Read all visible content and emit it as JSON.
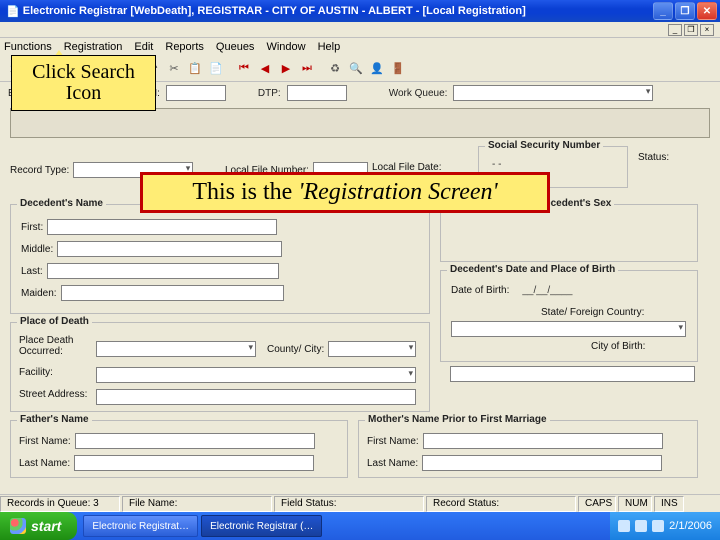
{
  "window": {
    "title": "Electronic Registrar [WebDeath], REGISTRAR - CITY OF AUSTIN - ALBERT  - [Local Registration]"
  },
  "menu": [
    "Functions",
    "Registration",
    "Edit",
    "Reports",
    "Queues",
    "Window",
    "Help"
  ],
  "toolbar": {
    "items": [
      "up",
      "binoc",
      "open",
      "save",
      "saveall",
      "print",
      "undo",
      "cut",
      "copy",
      "paste",
      "first",
      "prev",
      "next",
      "last",
      "upd",
      "audit",
      "person",
      "exit"
    ],
    "tooltip": "Find Record(s)"
  },
  "searchbar": {
    "edr": "EDR #:",
    "lfn": "LFN:",
    "dtp": "DTP:",
    "wq": "Work Queue:"
  },
  "labels": {
    "recType": "Record Type:",
    "locFile": "Local File Number:",
    "locFileDate": "Local File Date:",
    "ssn": "Social Security Number",
    "status": "Status:",
    "decName": "Decedent's Name",
    "first": "First:",
    "middle": "Middle:",
    "last": "Last:",
    "maiden": "Maiden:",
    "dodGroup": "Date of Death and Decedent's Sex",
    "dobGroup": "Decedent's Date and Place of Birth",
    "dob": "Date of Birth:",
    "state": "State/ Foreign Country:",
    "cityBirth": "City of Birth:",
    "pod": "Place of Death",
    "placeOcc": "Place Death Occurred:",
    "county": "County/ City:",
    "facility": "Facility:",
    "street": "Street Address:",
    "father": "Father's Name",
    "mother": "Mother's Name Prior to First Marriage",
    "fname": "First Name:",
    "lname": "Last Name:"
  },
  "values": {
    "dateMask": "__/__/____",
    "ssnMask": "   -   -"
  },
  "callouts": {
    "searchIcon": "Click Search Icon",
    "regScreen_a": "This is the ",
    "regScreen_b": "'Registration Screen'"
  },
  "status": {
    "recsQ": "Records in Queue: 3",
    "fileName": "File Name:",
    "fieldStatus": "Field Status:",
    "recStatus": "Record Status:",
    "caps": "CAPS",
    "num": "NUM",
    "ins": "INS"
  },
  "taskbar": {
    "start": "start",
    "t1": "Electronic Registrat…",
    "t2": "Electronic Registrar (…",
    "clock": "2/1/2006"
  }
}
